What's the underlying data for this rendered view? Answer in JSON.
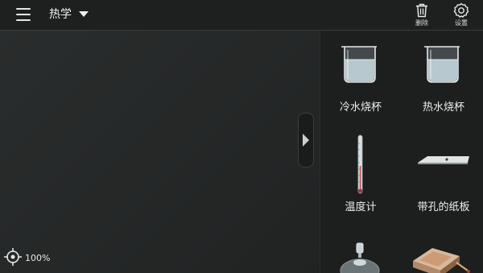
{
  "topbar": {
    "subject": "热学",
    "delete_label": "删除",
    "settings_label": "设置"
  },
  "panel": {
    "items": [
      {
        "label": "冷水烧杯",
        "icon": "cold-water-beaker-icon"
      },
      {
        "label": "热水烧杯",
        "icon": "hot-water-beaker-icon"
      },
      {
        "label": "温度计",
        "icon": "thermometer-icon"
      },
      {
        "label": "带孔的纸板",
        "icon": "perforated-cardboard-icon"
      },
      {
        "label": "",
        "icon": "alcohol-lamp-icon"
      },
      {
        "label": "",
        "icon": "matchbox-icon"
      }
    ]
  },
  "status": {
    "zoom": "100%"
  },
  "colors": {
    "background": "#232525",
    "panel": "#1d1f1f",
    "topbar": "#1e2020"
  }
}
